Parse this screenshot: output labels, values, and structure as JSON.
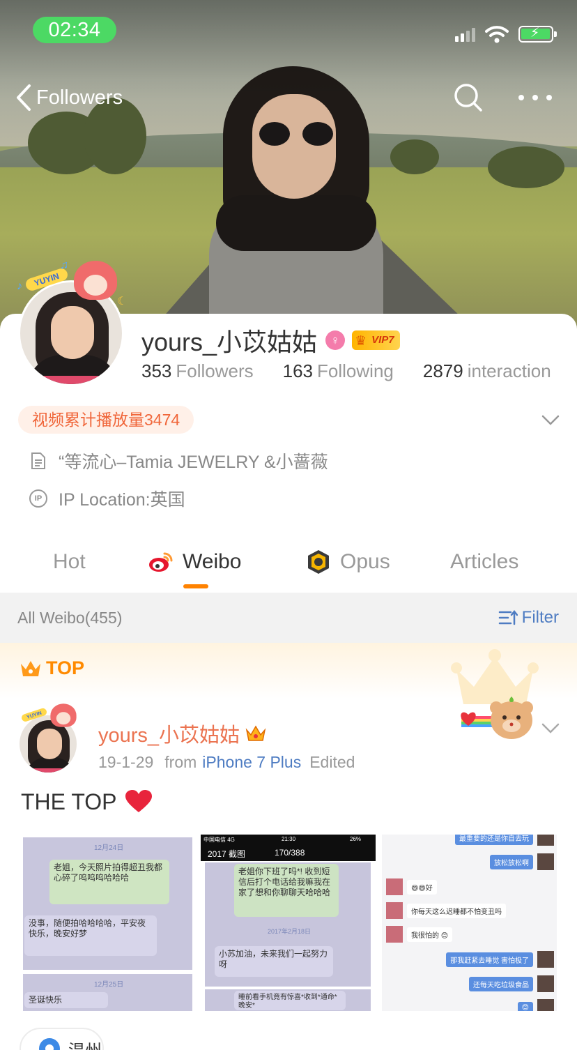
{
  "status_bar": {
    "time": "02:34"
  },
  "nav": {
    "back_label": "Followers"
  },
  "profile": {
    "name": "yours_小苡姑姑",
    "vip_label": "VIP7",
    "pendant_tag": "YUYIN",
    "stats": [
      {
        "count": "353",
        "label": "Followers"
      },
      {
        "count": "163",
        "label": "Following"
      },
      {
        "count": "2879",
        "label": "interaction"
      }
    ],
    "video_views": "视频累计播放量3474",
    "bio": "“等流心–Tamia JEWELRY &小蔷薇",
    "ip_location": "IP Location:英国"
  },
  "tabs": [
    {
      "label": "Hot",
      "active": false
    },
    {
      "label": "Weibo",
      "active": true
    },
    {
      "label": "Opus",
      "active": false
    },
    {
      "label": "Articles",
      "active": false
    }
  ],
  "filter_bar": {
    "all_weibo": "All Weibo(455)",
    "filter_label": "Filter"
  },
  "post": {
    "top_label": "TOP",
    "author": "yours_小苡姑姑",
    "date": "19-1-29",
    "from_label": "from",
    "source": "iPhone 7 Plus",
    "edited": "Edited",
    "text": "THE TOP",
    "images": {
      "img1": {
        "date_a": "12月24日",
        "msg_a": "老姐，今天照片拍得超丑我都心碎了呜呜呜哈哈哈",
        "msg_b": "没事，随便拍哈哈哈哈，平安夜快乐，晚安好梦",
        "date_b": "12月25日",
        "msg_c": "圣诞快乐"
      },
      "img2": {
        "carrier": "中国电信 4G",
        "clock": "21:30",
        "battery": "26%",
        "back": "2017 截图",
        "counter": "170/388",
        "msg_a": "老姐你下班了吗*! 收到短信后打个电话给我嘛我在家了想和你聊聊天哈哈哈",
        "date": "2017年2月18日",
        "msg_b": "小苏加油，未来我们一起努力呀",
        "msg_c": "睡前看手机竟有惊喜*收到*通命*晚安*"
      },
      "img3": {
        "msg_a": "最重要的还是你自去玩",
        "msg_b": "放松放松啊",
        "msg_c": "😄😄好",
        "msg_d": "你每天这么迟睡都不怕变丑吗",
        "msg_e": "我很怕的 😊",
        "msg_f": "那我赶紧去睡觉 害怕极了",
        "msg_g": "还每天吃垃圾食品",
        "msg_h": "😊"
      }
    },
    "location": "温州"
  }
}
